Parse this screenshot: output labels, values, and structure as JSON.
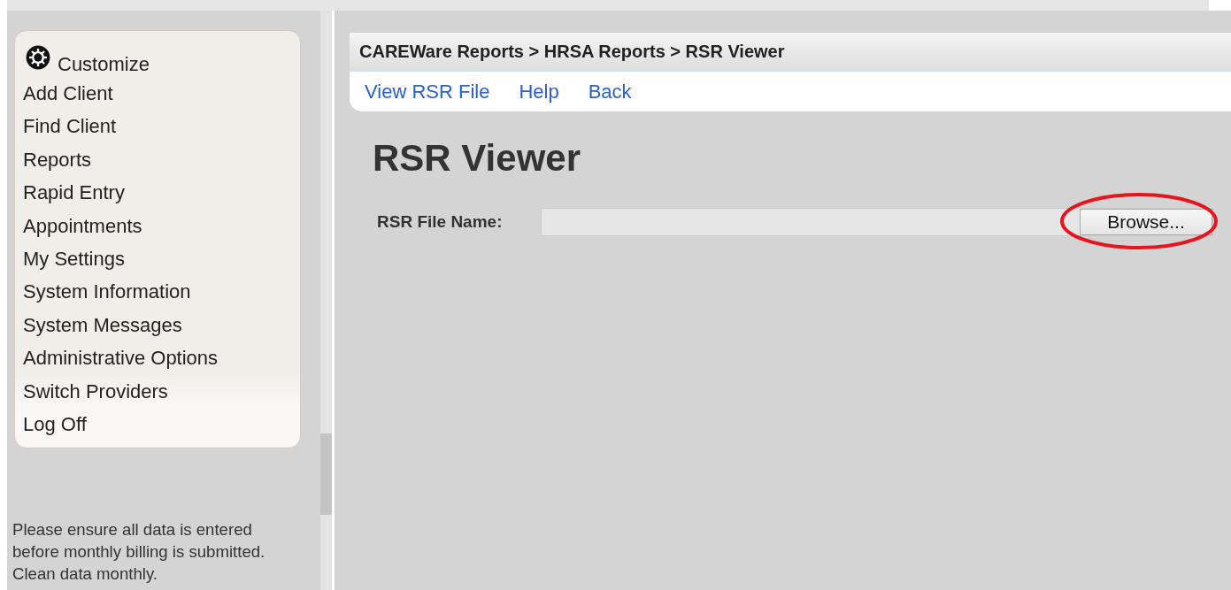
{
  "sidebar": {
    "customize": "Customize",
    "items": [
      {
        "label": "Add Client"
      },
      {
        "label": "Find Client"
      },
      {
        "label": "Reports"
      },
      {
        "label": "Rapid Entry"
      },
      {
        "label": "Appointments"
      },
      {
        "label": "My Settings"
      },
      {
        "label": "System Information"
      },
      {
        "label": "System Messages"
      },
      {
        "label": "Administrative Options"
      },
      {
        "label": "Switch Providers"
      },
      {
        "label": "Log Off"
      }
    ],
    "notice": "Please ensure all data is entered before monthly billing is submitted. Clean data monthly."
  },
  "breadcrumb": "CAREWare Reports > HRSA Reports > RSR Viewer",
  "nav_links": [
    "View RSR File",
    "Help",
    "Back"
  ],
  "page_title": "RSR Viewer",
  "file_field": {
    "label": "RSR File Name:",
    "button": "Browse...",
    "circled": true
  }
}
